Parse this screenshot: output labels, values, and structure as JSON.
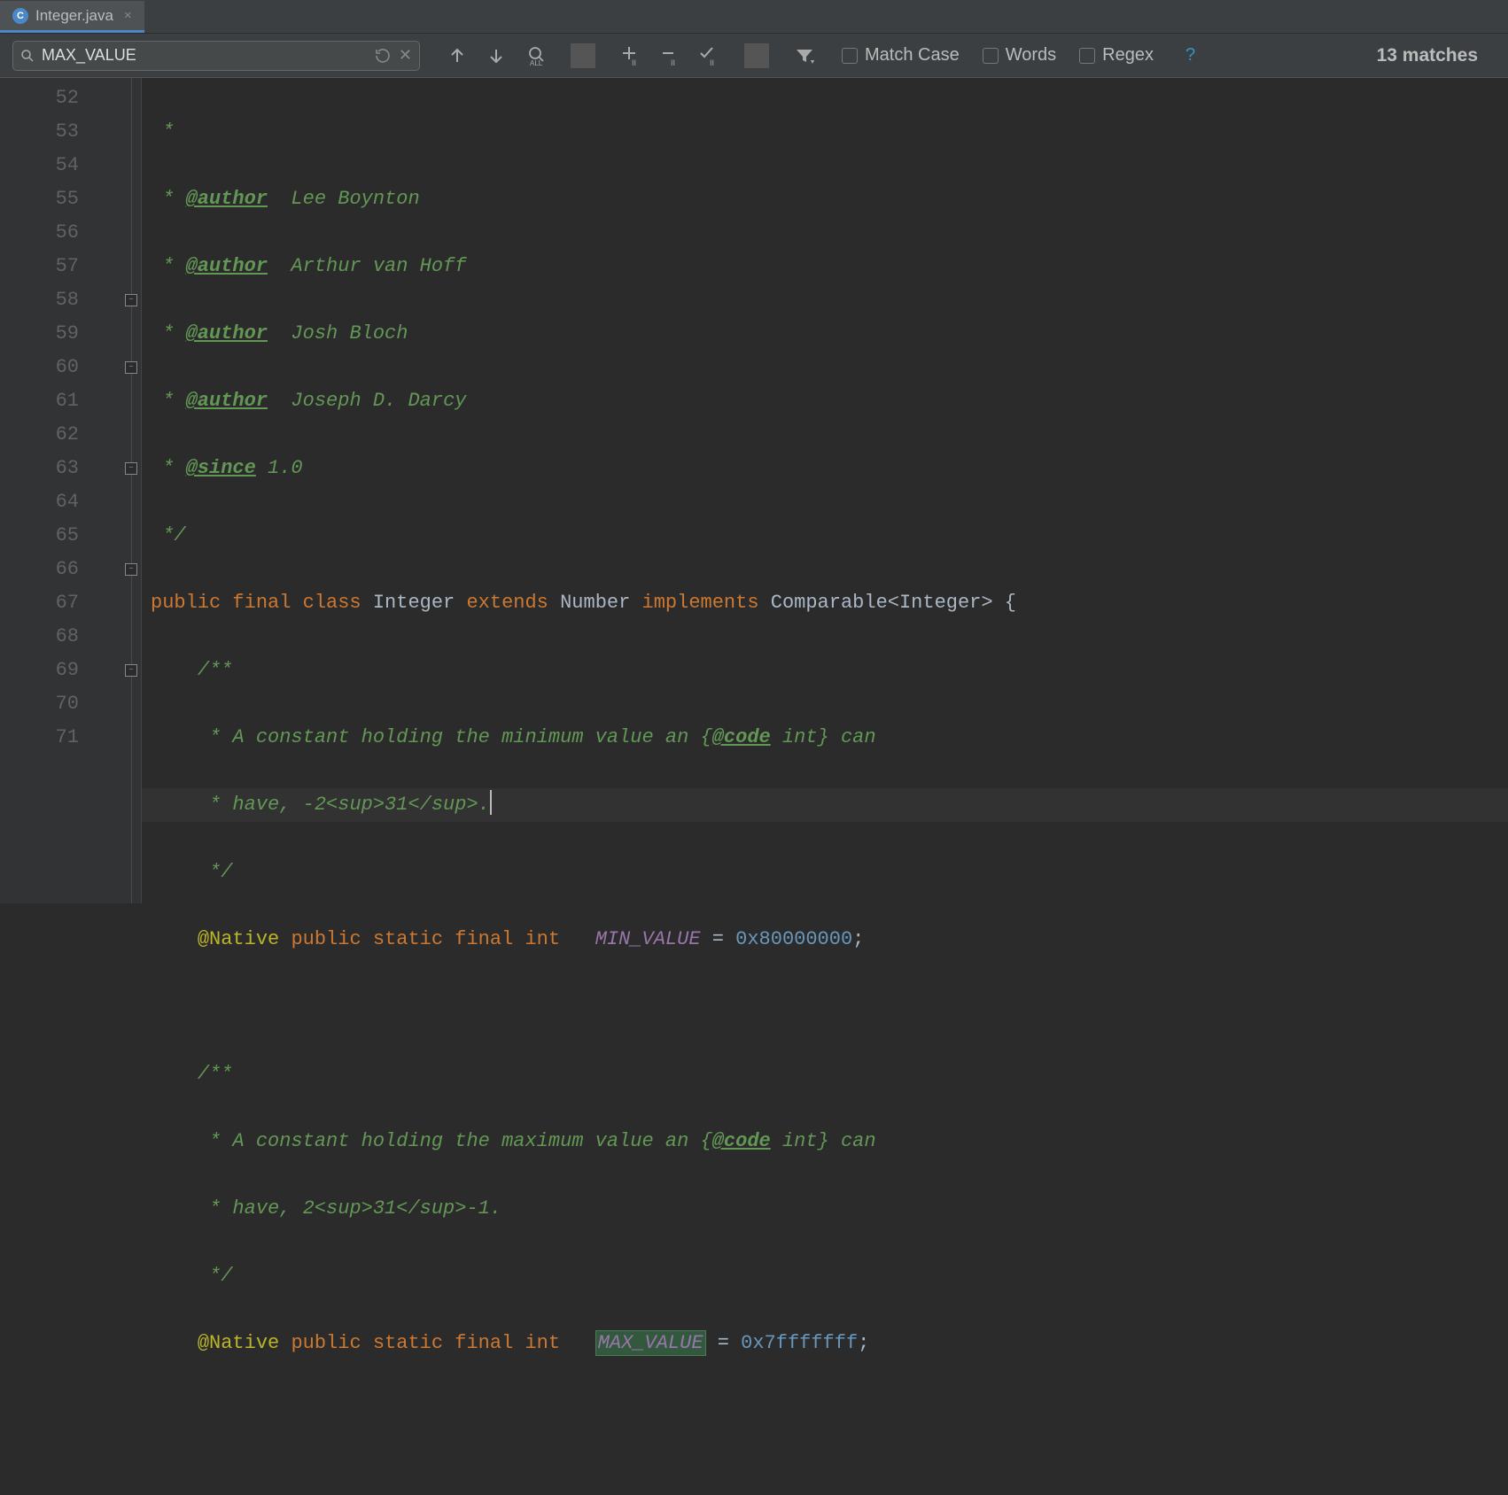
{
  "tab": {
    "filename": "Integer.java",
    "icon_letter": "C"
  },
  "find": {
    "query": "MAX_VALUE",
    "match_case_label": "Match Case",
    "words_label": "Words",
    "regex_label": "Regex",
    "matches_label": "13 matches"
  },
  "gutter": {
    "start": 52,
    "end": 71
  },
  "code": {
    "l52": " *",
    "l53_tag": "@author",
    "l53_txt": "  Lee Boynton",
    "l54_tag": "@author",
    "l54_txt": "  Arthur van Hoff",
    "l55_tag": "@author",
    "l55_txt": "  Josh Bloch",
    "l56_tag": "@author",
    "l56_txt": "  Joseph D. Darcy",
    "l57_tag": "@since",
    "l57_txt": " 1.0",
    "l58": " */",
    "l59_a": "public final class ",
    "l59_b": "Integer ",
    "l59_c": "extends ",
    "l59_d": "Number ",
    "l59_e": "implements ",
    "l59_f": "Comparable<Integer> {",
    "l60": "/**",
    "l61": " * A constant holding the minimum value an {",
    "l61_code": "@code",
    "l61_tail": " int} can",
    "l62": " * have, -2<sup>31</sup>.",
    "l63": " */",
    "l64_ann": "@Native ",
    "l64_kw": "public static final int   ",
    "l64_const": "MIN_VALUE",
    "l64_eq": " = ",
    "l64_num": "0x80000000",
    "l64_semi": ";",
    "l66": "/**",
    "l67": " * A constant holding the maximum value an {",
    "l67_code": "@code",
    "l67_tail": " int} can",
    "l68": " * have, 2<sup>31</sup>-1.",
    "l69": " */",
    "l70_ann": "@Native ",
    "l70_kw": "public static final int   ",
    "l70_const": "MAX_VALUE",
    "l70_eq": " = ",
    "l70_num": "0x7fffffff",
    "l70_semi": ";"
  }
}
